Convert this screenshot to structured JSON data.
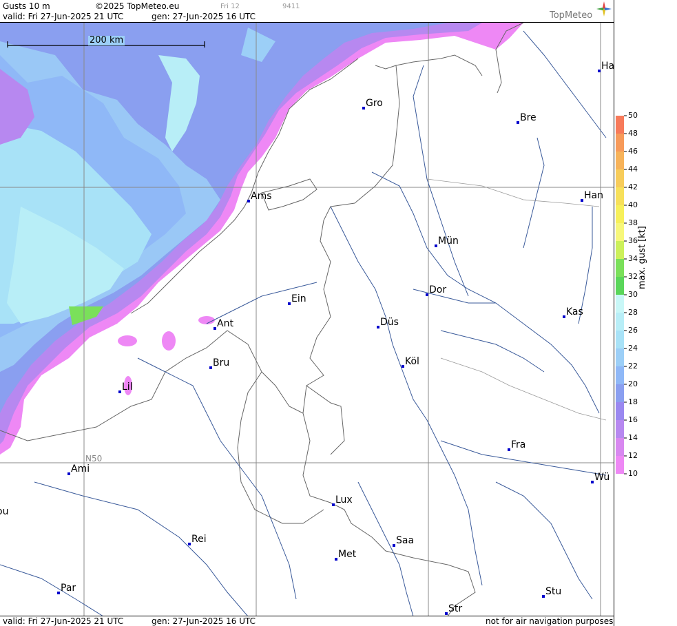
{
  "header": {
    "product": "Gusts 10 m",
    "copyright": "©2025 TopMeteo.eu",
    "run_tag": "Fri 12",
    "code": "9411",
    "valid": "valid:  Fri   27-Jun-2025  21 UTC",
    "gen": "gen: 27-Jun-2025 16 UTC",
    "brand": "TopMeteo"
  },
  "footer": {
    "valid": "valid:  Fri   27-Jun-2025  21 UTC",
    "gen": "gen: 27-Jun-2025 16 UTC",
    "disclaimer": "not for air navigation purposes"
  },
  "map": {
    "scale_label": "200 km",
    "lat_label": "N50",
    "cities": [
      {
        "label": "Ha"
      },
      {
        "label": "Gro"
      },
      {
        "label": "Bre"
      },
      {
        "label": "Ams"
      },
      {
        "label": "Han"
      },
      {
        "label": "Mün"
      },
      {
        "label": "Dor"
      },
      {
        "label": "Ein"
      },
      {
        "label": "Kas"
      },
      {
        "label": "Ant"
      },
      {
        "label": "Düs"
      },
      {
        "label": "Bru"
      },
      {
        "label": "Köl"
      },
      {
        "label": "Lil"
      },
      {
        "label": "Fra"
      },
      {
        "label": "Ami"
      },
      {
        "label": "Wü"
      },
      {
        "label": "ou"
      },
      {
        "label": "Lux"
      },
      {
        "label": "Rei"
      },
      {
        "label": "Saa"
      },
      {
        "label": "Met"
      },
      {
        "label": "Par"
      },
      {
        "label": "Stu"
      },
      {
        "label": "Str"
      }
    ]
  },
  "legend": {
    "axis_label": "max. gust [kt]",
    "ticks": [
      "50",
      "48",
      "46",
      "44",
      "42",
      "40",
      "38",
      "36",
      "34",
      "32",
      "30",
      "28",
      "26",
      "24",
      "22",
      "20",
      "18",
      "16",
      "14",
      "12",
      "10"
    ],
    "colors": [
      "#f77a5a",
      "#f79a5a",
      "#f7b35a",
      "#f7cc5a",
      "#f7e05a",
      "#f7f05a",
      "#f7f77a",
      "#ccf05a",
      "#7ae05a",
      "#5ad65a",
      "#c8f7f7",
      "#b8eef7",
      "#a8e2f7",
      "#9ccff7",
      "#8fb8f7",
      "#8a9ff0",
      "#9a88f0",
      "#b788f0",
      "#d888f0",
      "#ee88f5"
    ],
    "unit_note": "kt"
  }
}
